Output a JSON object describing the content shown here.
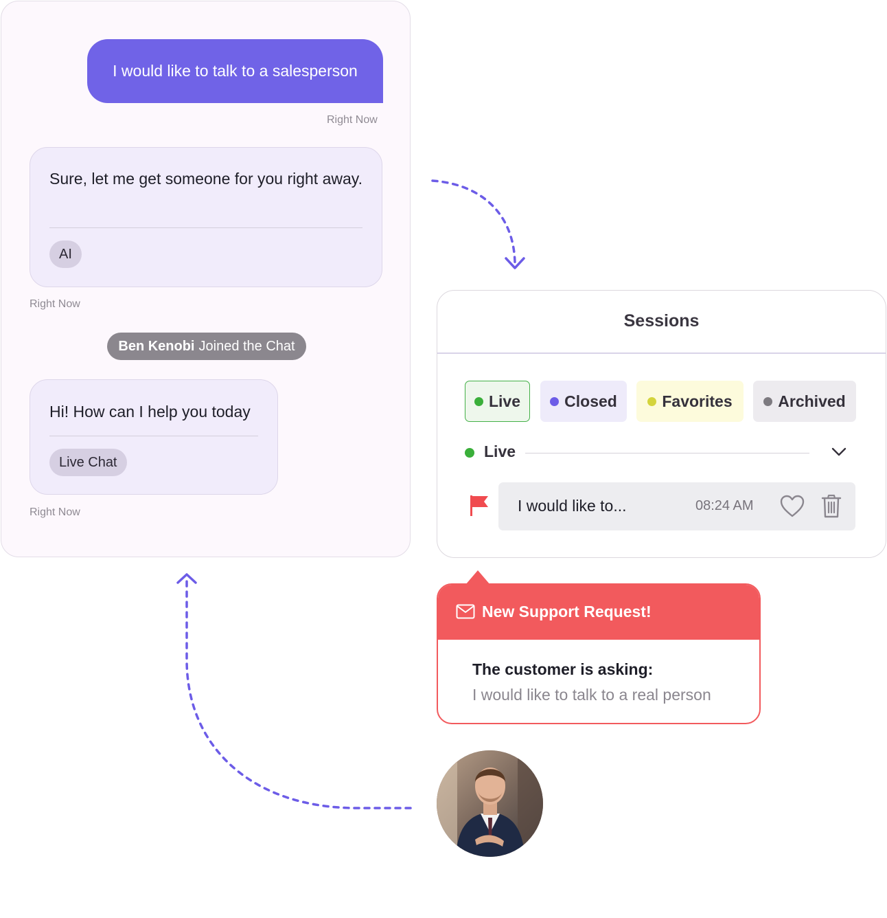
{
  "chat": {
    "user_message": "I would like to talk to a salesperson",
    "user_timestamp": "Right Now",
    "bot_message": "Sure, let me get someone for you right away.",
    "bot_chip": "AI",
    "bot_timestamp": "Right Now",
    "joined_name": "Ben Kenobi",
    "joined_text": "Joined the Chat",
    "agent_message": "Hi! How can I help you today",
    "agent_chip": "Live Chat",
    "agent_timestamp": "Right Now"
  },
  "sessions": {
    "title": "Sessions",
    "filters": [
      {
        "label": "Live",
        "color": "#3aaf3a"
      },
      {
        "label": "Closed",
        "color": "#6c5ce7"
      },
      {
        "label": "Favorites",
        "color": "#d4d43c"
      },
      {
        "label": "Archived",
        "color": "#7d7a80"
      }
    ],
    "group_label": "Live",
    "group_color": "#3aaf3a",
    "row": {
      "preview": "I would like to...",
      "time": "08:24 AM"
    }
  },
  "notification": {
    "title": "New Support Request!",
    "label": "The customer is asking:",
    "message": "I would like to talk to a real person"
  },
  "colors": {
    "accent": "#7063e7",
    "alert": "#f25a5d",
    "arrow": "#6c5ce7"
  },
  "icons": [
    "flag-icon",
    "heart-icon",
    "trash-icon",
    "chevron-down-icon",
    "envelope-icon"
  ]
}
